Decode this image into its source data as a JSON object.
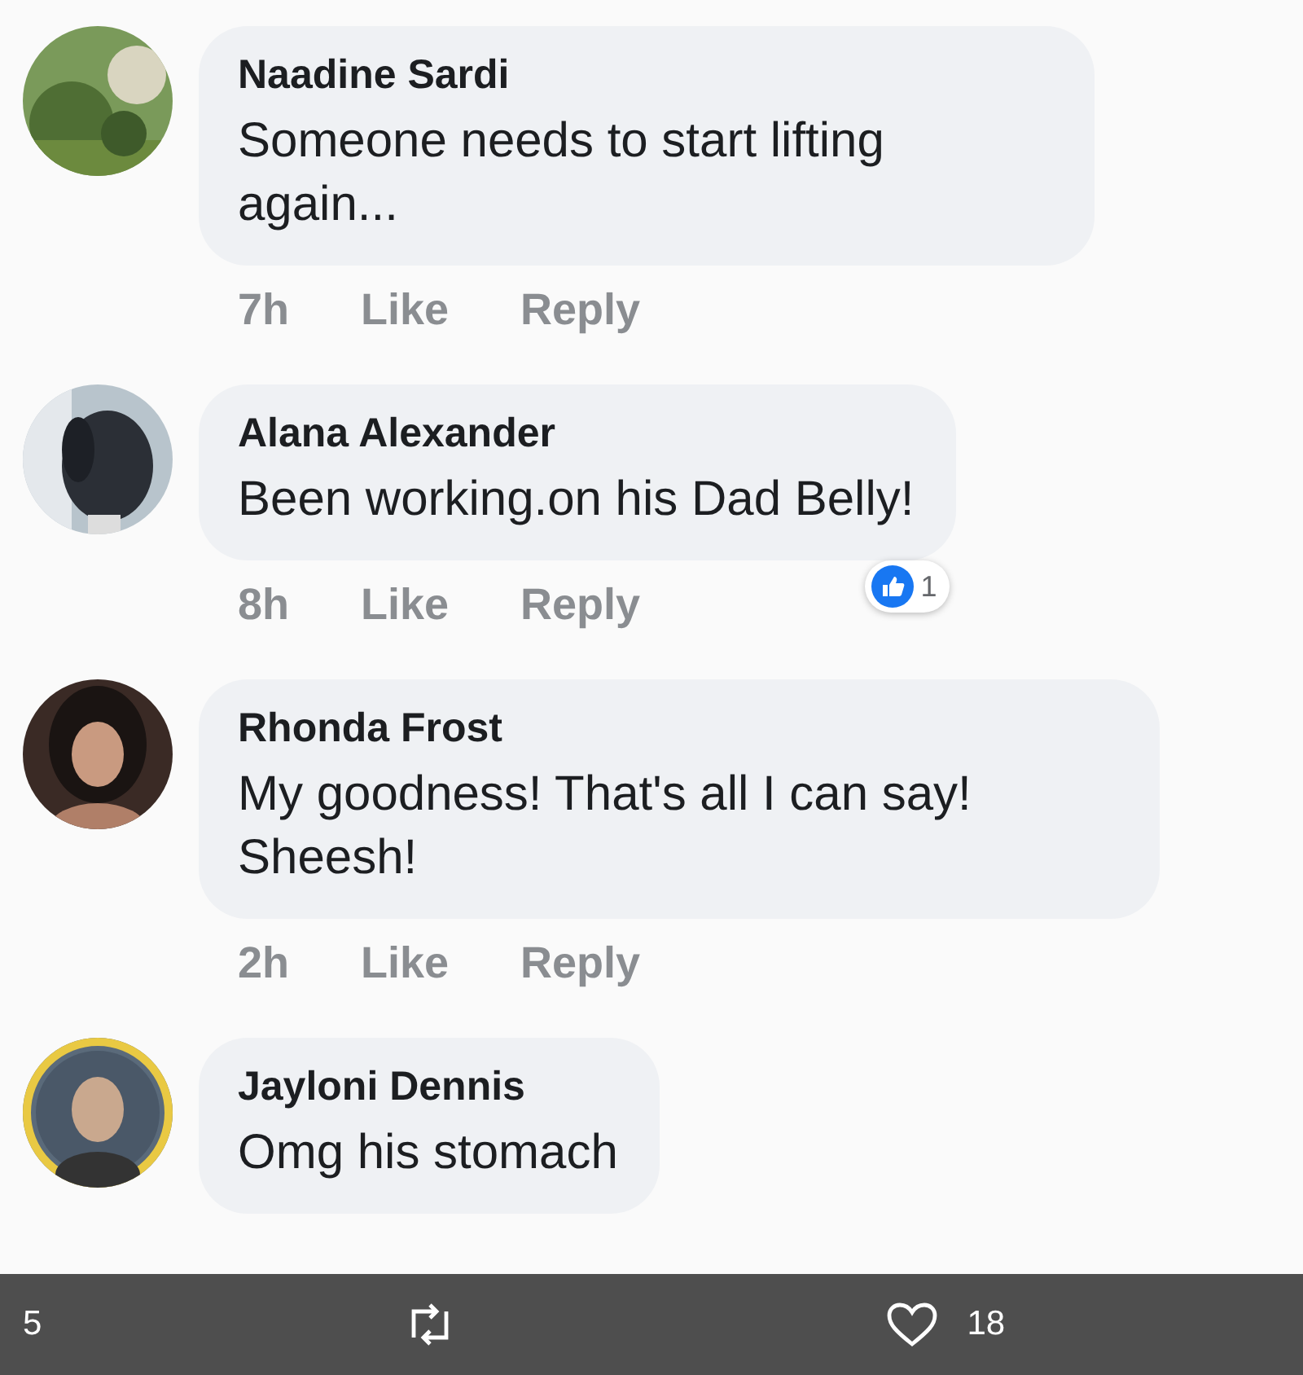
{
  "comments": [
    {
      "name": "Naadine Sardi",
      "text": "Someone needs to start lifting again...",
      "time": "7h",
      "actions": [
        "Like",
        "Reply"
      ]
    },
    {
      "name": "Alana Alexander",
      "text": "Been working.on his Dad Belly!",
      "time": "8h",
      "actions": [
        "Like",
        "Reply"
      ],
      "reaction_count": "1"
    },
    {
      "name": "Rhonda Frost",
      "text": "My goodness! That's all I can say! Sheesh!",
      "time": "2h",
      "actions": [
        "Like",
        "Reply"
      ]
    },
    {
      "name": "Jayloni Dennis",
      "text": "Omg his stomach"
    }
  ],
  "post_bar": {
    "reply_count": "5",
    "like_count": "18"
  }
}
